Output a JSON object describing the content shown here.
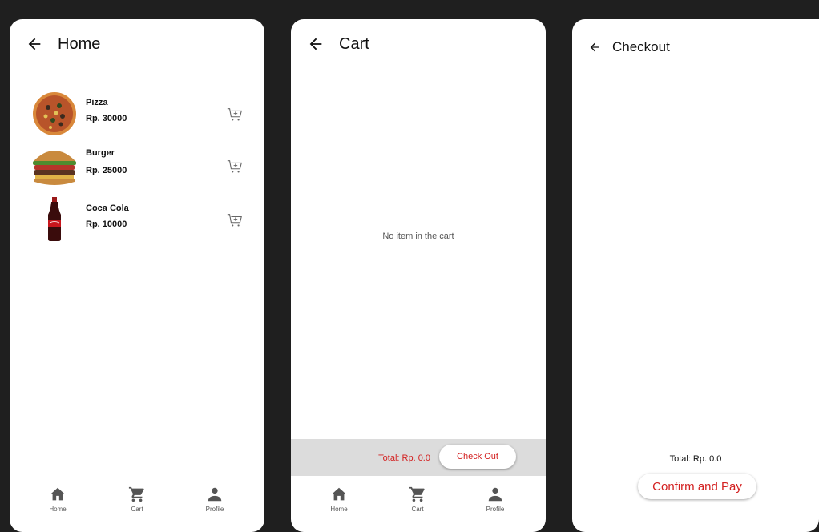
{
  "home": {
    "title": "Home",
    "items": [
      {
        "name": "Pizza",
        "price": "Rp. 30000",
        "image": "pizza-image"
      },
      {
        "name": "Burger",
        "price": "Rp. 25000",
        "image": "burger-image"
      },
      {
        "name": "Coca Cola",
        "price": "Rp. 10000",
        "image": "cola-bottle-image"
      }
    ]
  },
  "cart": {
    "title": "Cart",
    "empty_message": "No item in the cart",
    "total": "Total: Rp. 0.0",
    "checkout_label": "Check Out"
  },
  "checkout": {
    "title": "Checkout",
    "total": "Total: Rp. 0.0",
    "confirm_label": "Confirm and Pay"
  },
  "nav": {
    "home": "Home",
    "cart": "Cart",
    "profile": "Profile"
  },
  "icons": [
    "arrow-back-icon",
    "add-to-cart-icon",
    "home-icon",
    "cart-icon",
    "profile-icon"
  ],
  "colors": {
    "accent": "#d32020",
    "background": "#1f1f1f",
    "bar": "#dcdcdc",
    "nav": "#555555"
  }
}
